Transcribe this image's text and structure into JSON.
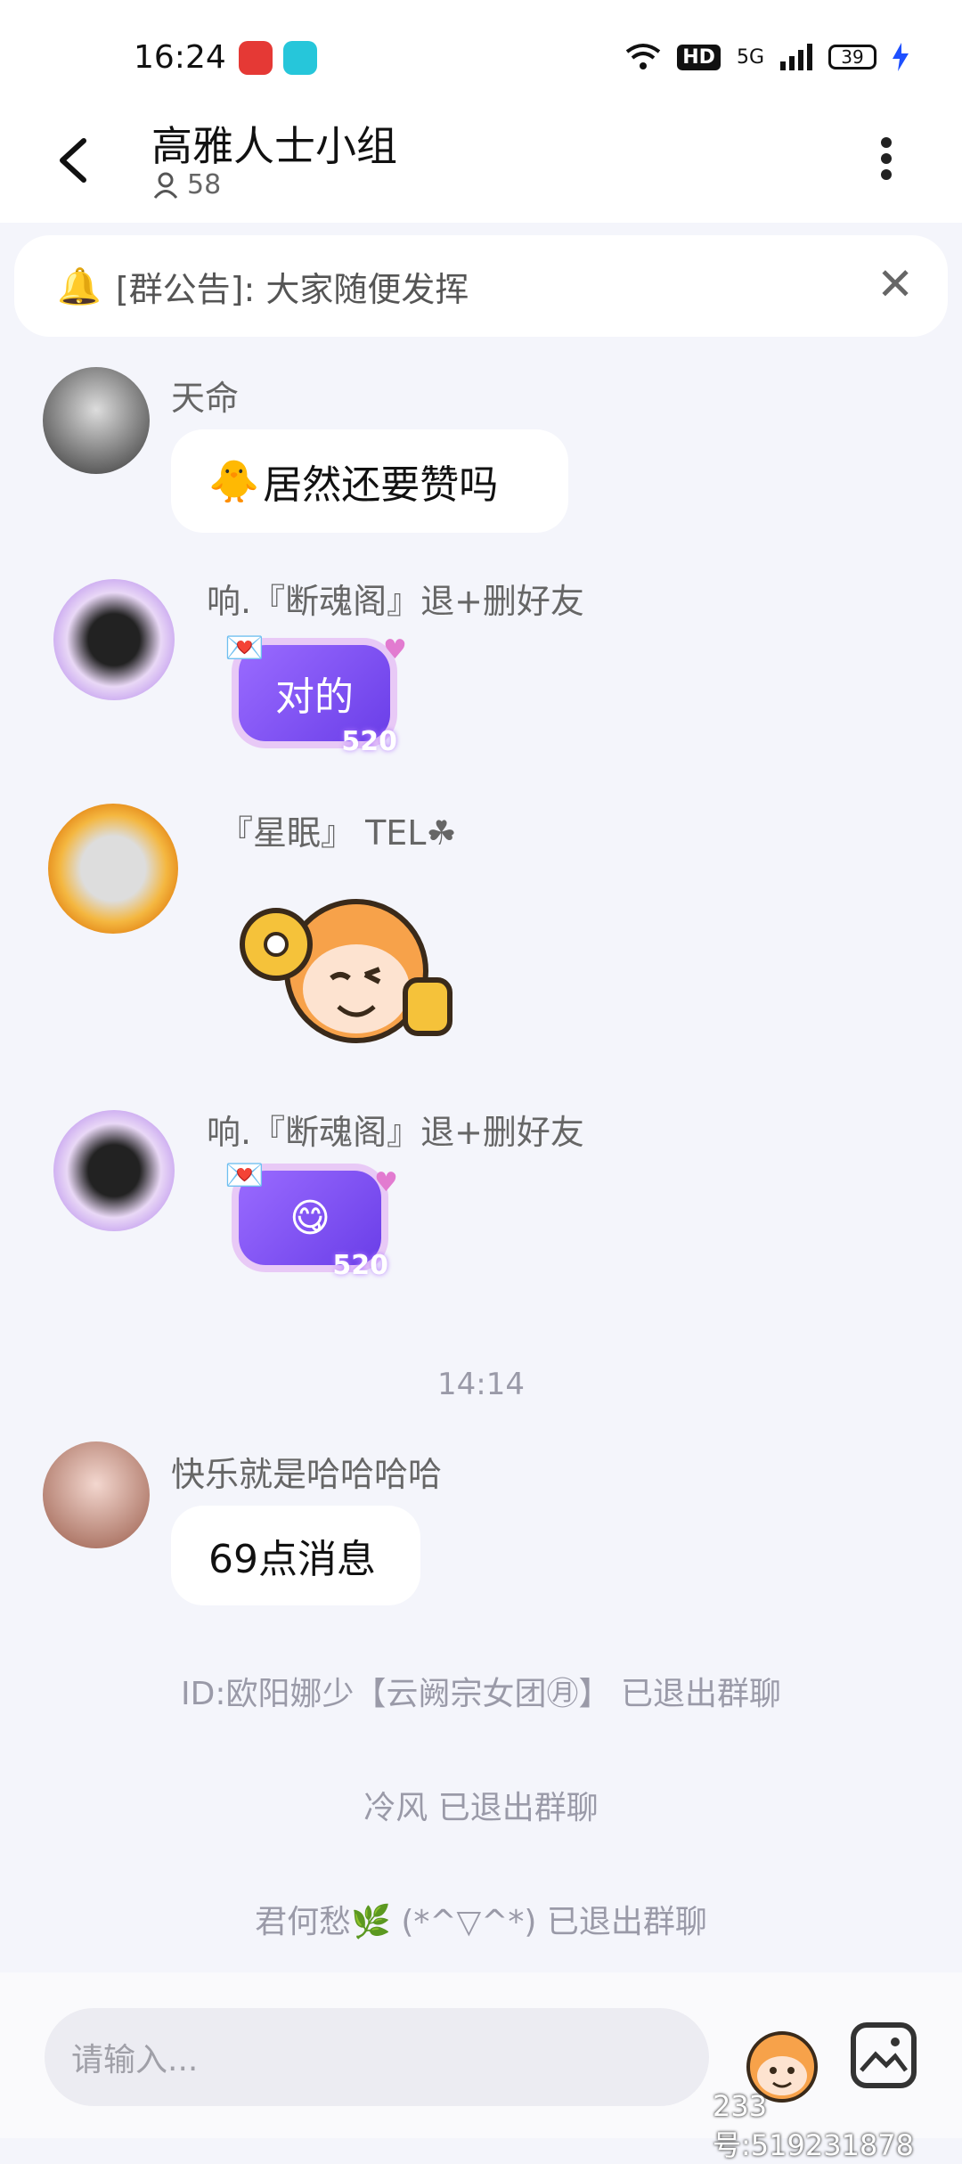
{
  "status_bar": {
    "time": "16:24",
    "network": "5G",
    "hd": "HD",
    "battery": "39"
  },
  "header": {
    "title": "高雅人士小组",
    "member_count": "58"
  },
  "notice": {
    "text": "[群公告]: 大家随便发挥"
  },
  "messages": [
    {
      "sender": "天命",
      "text": "居然还要赞吗"
    },
    {
      "sender": "响.『断魂阁』退+删好友",
      "text": "对的",
      "badge": "520"
    },
    {
      "sender": "『星眠』 TEL☘"
    },
    {
      "sender": "响.『断魂阁』退+删好友",
      "emoji": "😋",
      "badge": "520"
    }
  ],
  "time_divider": "14:14",
  "message2": {
    "sender": "快乐就是哈哈哈哈",
    "text": "69点消息"
  },
  "system_messages": [
    "ID:欧阳娜少【云阙宗女团㊊】 已退出群聊",
    "冷风 已退出群聊",
    "君何愁🌿 (*^▽^*) 已退出群聊"
  ],
  "input": {
    "placeholder": "请输入..."
  },
  "watermark": "233号:519231878",
  "colors": {
    "accent": "#7a4ef0",
    "bubble_bg": "#ffffff",
    "page_bg": "#f4f5fb"
  }
}
